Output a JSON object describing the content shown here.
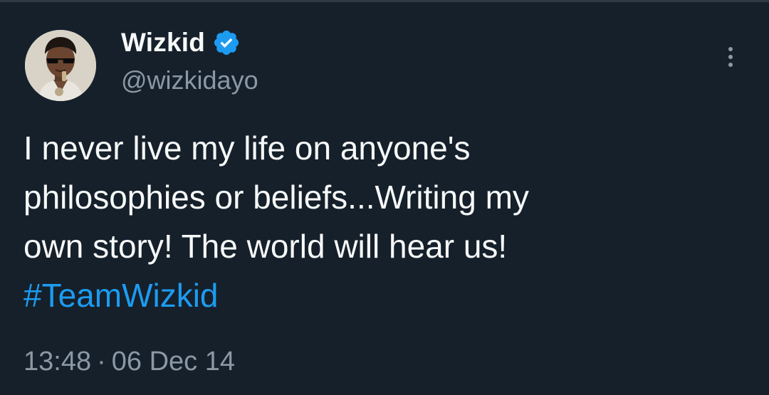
{
  "tweet": {
    "author": {
      "display_name": "Wizkid",
      "handle": "@wizkidayo",
      "verified": true,
      "avatar_icon": "profile-photo"
    },
    "text_lines": [
      "I never live my life on anyone's",
      "philosophies or beliefs...Writing my",
      "own story! The world will hear us!"
    ],
    "hashtag": "#TeamWizkid",
    "time": "13:48",
    "separator": "·",
    "date": "06 Dec 14",
    "more_icon": "more-vertical-icon"
  },
  "colors": {
    "background": "#15202b",
    "text": "#f7f9f9",
    "muted": "#8b98a5",
    "accent": "#1d9bf0"
  }
}
